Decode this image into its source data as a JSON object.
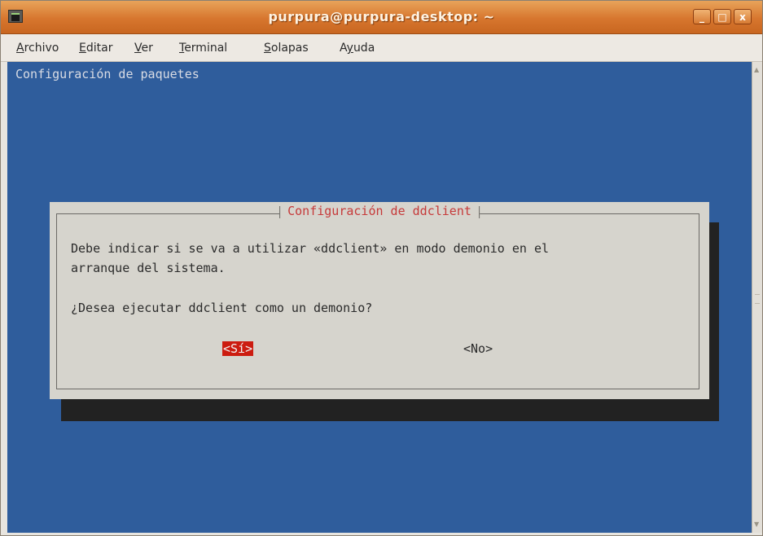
{
  "window": {
    "title": "purpura@purpura-desktop: ~",
    "controls": {
      "minimize": "_",
      "maximize": "□",
      "close": "x"
    }
  },
  "menubar": {
    "items": [
      {
        "mnemonic": "A",
        "rest": "rchivo"
      },
      {
        "mnemonic": "E",
        "rest": "ditar"
      },
      {
        "mnemonic": "V",
        "rest": "er"
      },
      {
        "mnemonic": "T",
        "rest": "erminal"
      },
      {
        "mnemonic": "S",
        "rest": "olapas"
      },
      {
        "prefix": "A",
        "mnemonic": "y",
        "rest": "uda"
      }
    ]
  },
  "terminal": {
    "header": "Configuración de paquetes",
    "background": "#2f5d9c"
  },
  "dialog": {
    "title": "Configuración de ddclient",
    "line1": "Debe indicar si se va a utilizar «ddclient» en modo demonio en el",
    "line2": "arranque del sistema.",
    "question": "¿Desea ejecutar ddclient como un demonio?",
    "yes_button": "<Sí>",
    "no_button": "<No>",
    "selected_color": "#cc1c10",
    "title_color": "#c63a3a"
  }
}
